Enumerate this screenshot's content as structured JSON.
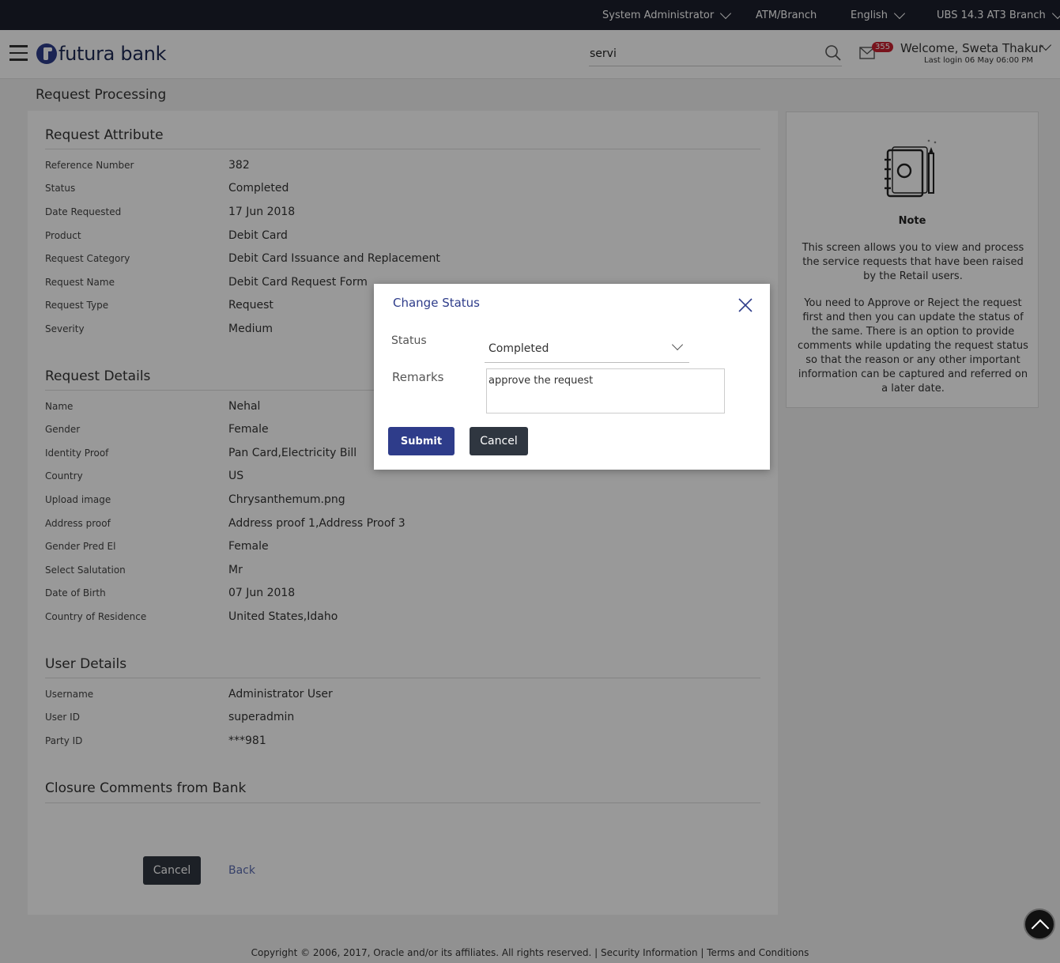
{
  "topbar": {
    "role": "System Administrator",
    "atm_branch": "ATM/Branch",
    "language": "English",
    "branch": "UBS 14.3 AT3 Branch"
  },
  "header": {
    "logo_text": "futura bank",
    "search_value": "servi",
    "notification_count": "355",
    "welcome": "Welcome, Sweta Thakur",
    "last_login": "Last login 06 May 06:00 PM"
  },
  "page": {
    "title": "Request Processing"
  },
  "request_attribute": {
    "title": "Request Attribute",
    "rows": [
      {
        "label": "Reference Number",
        "value": "382"
      },
      {
        "label": "Status",
        "value": "Completed"
      },
      {
        "label": "Date Requested",
        "value": "17 Jun 2018"
      },
      {
        "label": "Product",
        "value": "Debit Card"
      },
      {
        "label": "Request Category",
        "value": "Debit Card Issuance and Replacement"
      },
      {
        "label": "Request Name",
        "value": "Debit Card Request Form"
      },
      {
        "label": "Request Type",
        "value": "Request"
      },
      {
        "label": "Severity",
        "value": "Medium"
      }
    ]
  },
  "request_details": {
    "title": "Request Details",
    "rows": [
      {
        "label": "Name",
        "value": "Nehal"
      },
      {
        "label": "Gender",
        "value": "Female"
      },
      {
        "label": "Identity Proof",
        "value": "Pan Card,Electricity Bill"
      },
      {
        "label": "Country",
        "value": "US"
      },
      {
        "label": "Upload image",
        "value": "Chrysanthemum.png"
      },
      {
        "label": "Address proof",
        "value": "Address proof 1,Address Proof 3"
      },
      {
        "label": "Gender Pred El",
        "value": "Female"
      },
      {
        "label": "Select Salutation",
        "value": "Mr"
      },
      {
        "label": "Date of Birth",
        "value": "07 Jun 2018"
      },
      {
        "label": "Country of Residence",
        "value": "United States,Idaho"
      }
    ]
  },
  "user_details": {
    "title": "User Details",
    "rows": [
      {
        "label": "Username",
        "value": "Administrator User"
      },
      {
        "label": "User ID",
        "value": "superadmin"
      },
      {
        "label": "Party ID",
        "value": "***981"
      }
    ]
  },
  "closure": {
    "title": "Closure Comments from Bank"
  },
  "actions": {
    "cancel_label": "Cancel",
    "back_label": "Back"
  },
  "note": {
    "title": "Note",
    "para1": "This screen allows you to view and process the service requests that have been raised by the Retail users.",
    "para2": "You need to Approve or Reject the request first and then you can update the status of the same. There is an option to provide comments while updating the request status so that the reason or any other important information can be captured and referred on a later date."
  },
  "modal": {
    "title": "Change Status",
    "status_label": "Status",
    "status_value": "Completed",
    "remarks_label": "Remarks",
    "remarks_value": "approve the request",
    "submit_label": "Submit",
    "cancel_label": "Cancel"
  },
  "footer": {
    "text": "Copyright © 2006, 2017, Oracle and/or its affiliates. All rights reserved. | Security Information | Terms and Conditions"
  },
  "colors": {
    "topbar_bg": "#1b1e2c",
    "brand_blue": "#2e3c8a",
    "badge_red": "#c8202f",
    "dark_button": "#2f3640"
  },
  "icons": [
    "hamburger-icon",
    "search-icon",
    "mail-icon",
    "chevron-down-icon",
    "close-icon",
    "notebook-icon",
    "arrow-up-icon"
  ]
}
